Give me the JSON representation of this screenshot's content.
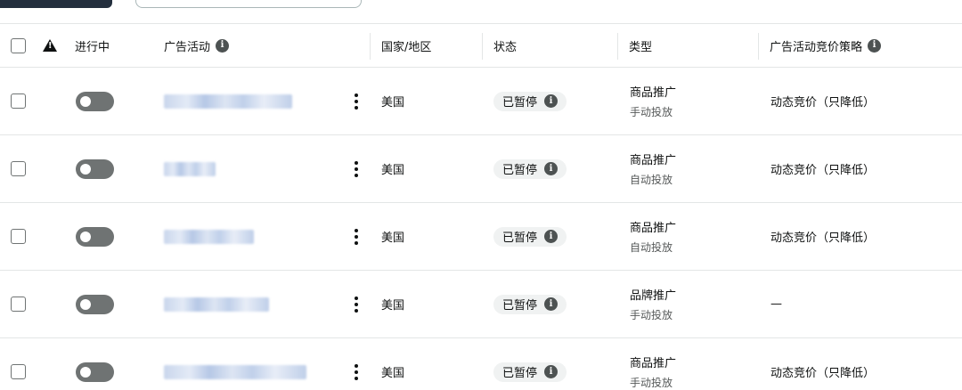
{
  "header": {
    "active_label": "进行中",
    "campaign_label": "广告活动",
    "country_label": "国家/地区",
    "status_label": "状态",
    "type_label": "类型",
    "bidding_label": "广告活动竞价策略"
  },
  "rows": [
    {
      "country": "美国",
      "status": "已暂停",
      "type": "商品推广",
      "targeting": "手动投放",
      "bidding": "动态竞价（只降低）"
    },
    {
      "country": "美国",
      "status": "已暂停",
      "type": "商品推广",
      "targeting": "自动投放",
      "bidding": "动态竞价（只降低）"
    },
    {
      "country": "美国",
      "status": "已暂停",
      "type": "商品推广",
      "targeting": "自动投放",
      "bidding": "动态竞价（只降低）"
    },
    {
      "country": "美国",
      "status": "已暂停",
      "type": "品牌推广",
      "targeting": "手动投放",
      "bidding": "—"
    },
    {
      "country": "美国",
      "status": "已暂停",
      "type": "商品推广",
      "targeting": "手动投放",
      "bidding": "动态竞价（只降低）"
    }
  ],
  "icons": {
    "info": "info-icon",
    "warning": "warning-icon",
    "more": "kebab-menu-icon"
  }
}
